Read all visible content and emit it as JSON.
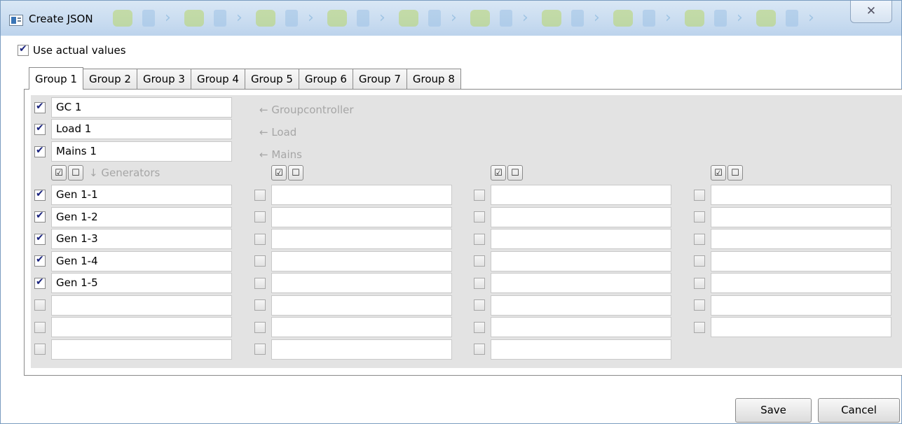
{
  "window": {
    "title": "Create JSON",
    "close_glyph": "✕"
  },
  "use_actual": {
    "label": "Use actual values",
    "checked": true
  },
  "tabs": [
    "Group 1",
    "Group 2",
    "Group 3",
    "Group 4",
    "Group 5",
    "Group 6",
    "Group 7",
    "Group 8"
  ],
  "active_tab": "Group 1",
  "top_rows": [
    {
      "value": "GC 1",
      "hint": "← Groupcontroller",
      "checked": true
    },
    {
      "value": "Load 1",
      "hint": "← Load",
      "checked": true
    },
    {
      "value": "Mains 1",
      "hint": "← Mains",
      "checked": true
    }
  ],
  "generators_hint": "↓ Generators",
  "column_buttons": {
    "check_all_glyph": "☑",
    "uncheck_all_glyph": "☐"
  },
  "columns": [
    {
      "rows": [
        {
          "checked": true,
          "value": "Gen 1-1"
        },
        {
          "checked": true,
          "value": "Gen 1-2"
        },
        {
          "checked": true,
          "value": "Gen 1-3"
        },
        {
          "checked": true,
          "value": "Gen 1-4"
        },
        {
          "checked": true,
          "value": "Gen 1-5"
        },
        {
          "checked": false,
          "value": ""
        },
        {
          "checked": false,
          "value": ""
        },
        {
          "checked": false,
          "value": ""
        }
      ]
    },
    {
      "rows": [
        {
          "checked": false,
          "value": ""
        },
        {
          "checked": false,
          "value": ""
        },
        {
          "checked": false,
          "value": ""
        },
        {
          "checked": false,
          "value": ""
        },
        {
          "checked": false,
          "value": ""
        },
        {
          "checked": false,
          "value": ""
        },
        {
          "checked": false,
          "value": ""
        },
        {
          "checked": false,
          "value": ""
        }
      ]
    },
    {
      "rows": [
        {
          "checked": false,
          "value": ""
        },
        {
          "checked": false,
          "value": ""
        },
        {
          "checked": false,
          "value": ""
        },
        {
          "checked": false,
          "value": ""
        },
        {
          "checked": false,
          "value": ""
        },
        {
          "checked": false,
          "value": ""
        },
        {
          "checked": false,
          "value": ""
        },
        {
          "checked": false,
          "value": ""
        }
      ]
    },
    {
      "rows": [
        {
          "checked": false,
          "value": ""
        },
        {
          "checked": false,
          "value": ""
        },
        {
          "checked": false,
          "value": ""
        },
        {
          "checked": false,
          "value": ""
        },
        {
          "checked": false,
          "value": ""
        },
        {
          "checked": false,
          "value": ""
        },
        {
          "checked": false,
          "value": ""
        }
      ]
    }
  ],
  "footer": {
    "save_label": "Save",
    "cancel_label": "Cancel"
  },
  "colors": {
    "titlebar": "#c9dcf0",
    "panel_gray": "#e3e3e3",
    "hint_text": "#a6a6a6",
    "check_mark": "#1a237e"
  }
}
